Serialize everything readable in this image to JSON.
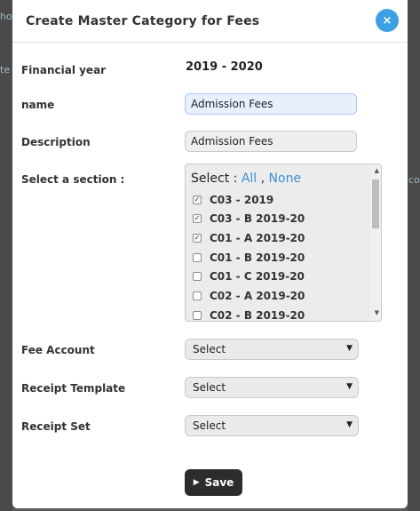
{
  "background": {
    "left_fragment_1": "ho",
    "left_fragment_2": "te",
    "right_fragment": "co"
  },
  "modal": {
    "title": "Create Master Category for Fees",
    "close_glyph": "×"
  },
  "form": {
    "financial_year_label": "Financial year",
    "financial_year_value": "2019 - 2020",
    "name_label": "name",
    "name_value": "Admission Fees",
    "description_label": "Description",
    "description_value": "Admission Fees",
    "section_label": "Select a section :",
    "section_select_prefix": "Select : ",
    "section_all": "All",
    "section_sep": " , ",
    "section_none": "None",
    "sections": [
      {
        "label": "C03 - 2019",
        "checked": true
      },
      {
        "label": "C03 - B 2019-20",
        "checked": true
      },
      {
        "label": "C01 - A 2019-20",
        "checked": true
      },
      {
        "label": "C01 - B 2019-20",
        "checked": false
      },
      {
        "label": "C01 - C 2019-20",
        "checked": false
      },
      {
        "label": "C02 - A 2019-20",
        "checked": false
      },
      {
        "label": "C02 - B 2019-20",
        "checked": false
      }
    ],
    "fee_account_label": "Fee Account",
    "fee_account_value": "Select",
    "receipt_template_label": "Receipt Template",
    "receipt_template_value": "Select",
    "receipt_set_label": "Receipt Set",
    "receipt_set_value": "Select",
    "save_label": "Save",
    "save_icon_glyph": "▶"
  },
  "colors": {
    "accent": "#3ea0e4",
    "link": "#3b8fd9",
    "button_dark": "#2c2c2c"
  }
}
